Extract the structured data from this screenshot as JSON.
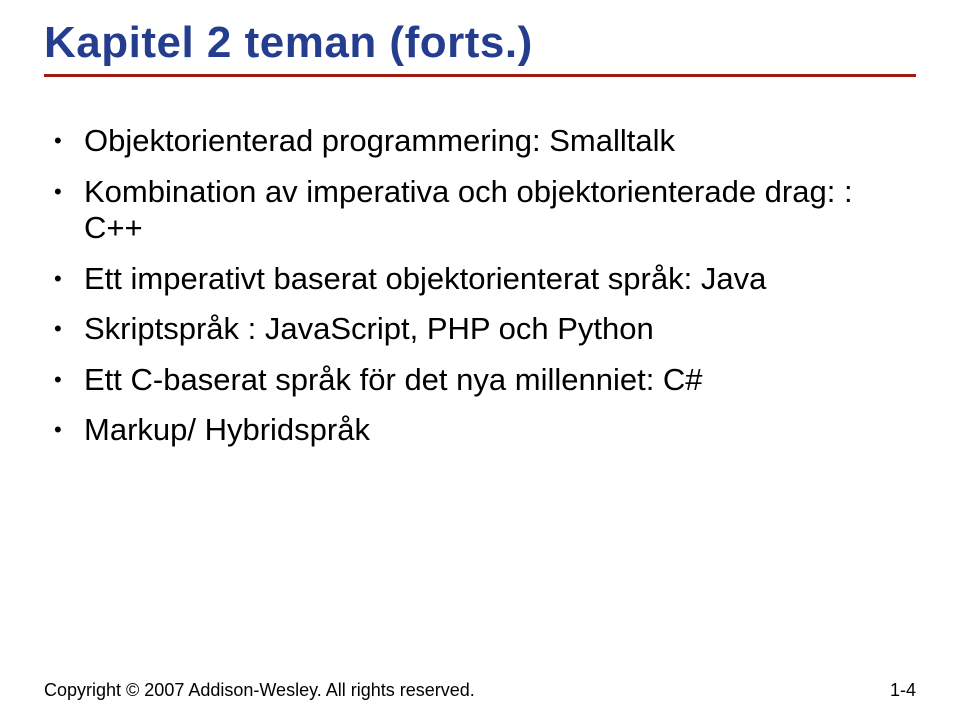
{
  "title": "Kapitel 2 teman (forts.)",
  "bullets": [
    "Objektorienterad programmering: Smalltalk",
    "Kombination av imperativa och objektorienterade drag: : C++",
    "Ett imperativt baserat objektorienterat språk: Java",
    "Skriptspråk : JavaScript, PHP och Python",
    "Ett C-baserat språk för det nya millenniet: C#",
    "Markup/ Hybridspråk"
  ],
  "footer": {
    "copyright": "Copyright © 2007 Addison-Wesley. All rights reserved.",
    "page": "1-4"
  }
}
